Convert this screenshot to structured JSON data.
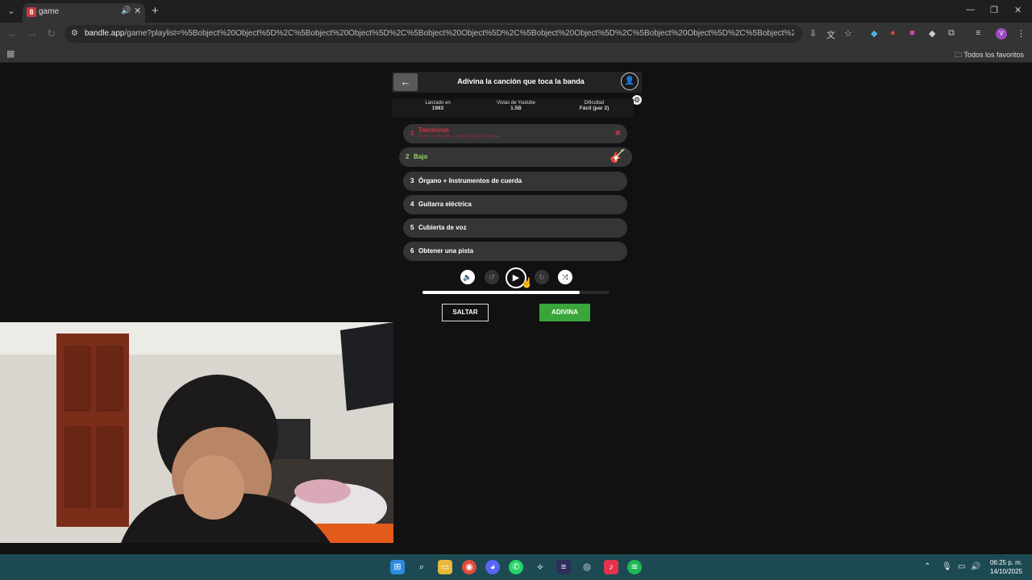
{
  "browser": {
    "tab_title": "game",
    "tab_favicon": "8",
    "url_domain": "bandle.app",
    "url_rest": "/game?playlist=%5Bobject%20Object%5D%2C%5Bobject%20Object%5D%2C%5Bobject%20Object%5D%2C%5Bobject%20Object%5D%2C%5Bobject%20Object%5D%2C%5Bobject%20Object%5D%2C%5Bobject%20Object%5D",
    "profile_initial": "V",
    "bookmarks_label": "Todos los favoritos"
  },
  "game": {
    "title": "Adivina la canción que toca la banda",
    "stats": [
      {
        "label": "Lanzado en",
        "value": "1983"
      },
      {
        "label": "Vistas de Youtube",
        "value": "1.5B"
      },
      {
        "label": "Dificultad",
        "value": "Fácil (par 2)"
      }
    ],
    "clues": [
      {
        "num": "1",
        "label": "Tamborus",
        "sub": "Guns N' Roses · Sweet Child O' Mine",
        "state": "wrong"
      },
      {
        "num": "2",
        "label": "Bajo",
        "state": "active"
      },
      {
        "num": "3",
        "label": "Órgano + Instrumentos de cuerda",
        "state": "locked"
      },
      {
        "num": "4",
        "label": "Guitarra eléctrica",
        "state": "locked"
      },
      {
        "num": "5",
        "label": "Cubierta de voz",
        "state": "locked"
      },
      {
        "num": "6",
        "label": "Obtener una pista",
        "state": "locked"
      }
    ],
    "progress": 0.84,
    "skip_label": "SALTAR",
    "guess_label": "ADIVINA"
  },
  "colors": {
    "accent_green": "#3aa53a",
    "wrong_red": "#c0394b",
    "active_green": "#9bd36a"
  },
  "taskbar": {
    "time": "06:25 p. m.",
    "date": "14/10/2025"
  }
}
